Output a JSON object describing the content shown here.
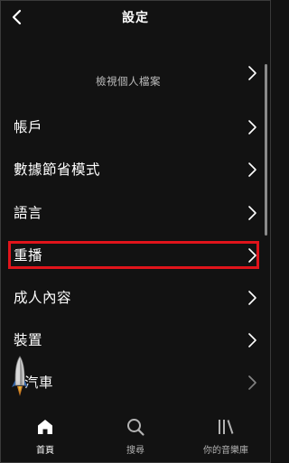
{
  "header": {
    "title": "設定",
    "back_icon": "chevron-left-icon"
  },
  "profile": {
    "label": "檢視個人檔案"
  },
  "settings": {
    "items": [
      {
        "label": "帳戶"
      },
      {
        "label": "數據節省模式"
      },
      {
        "label": "語言"
      },
      {
        "label": "重播"
      },
      {
        "label": "成人內容"
      },
      {
        "label": "裝置"
      },
      {
        "label": "汽車"
      }
    ],
    "highlighted_index": 3
  },
  "bottom_nav": {
    "items": [
      {
        "label": "首頁",
        "icon": "home-icon",
        "active": true
      },
      {
        "label": "搜尋",
        "icon": "search-icon",
        "active": false
      },
      {
        "label": "你的音樂庫",
        "icon": "library-icon",
        "active": false
      }
    ]
  },
  "colors": {
    "background": "#121212",
    "text": "#ffffff",
    "secondary_text": "#b3b3b3",
    "highlight_border": "#e0141b"
  }
}
